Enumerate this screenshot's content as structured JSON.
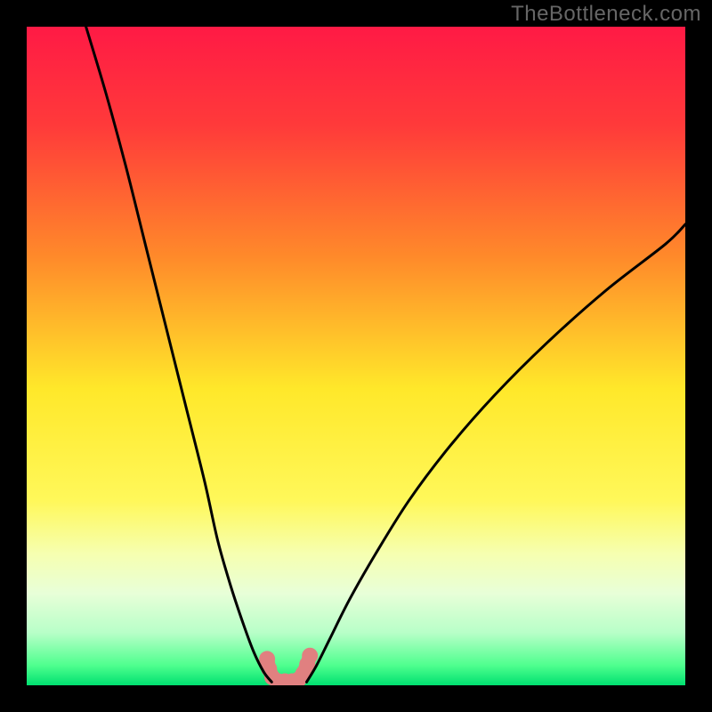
{
  "watermark": "TheBottleneck.com",
  "chart_data": {
    "type": "line",
    "title": "",
    "xlabel": "",
    "ylabel": "",
    "xlim": [
      0,
      100
    ],
    "ylim": [
      0,
      100
    ],
    "background_gradient": {
      "stops": [
        {
          "offset": 0.0,
          "color": "#ff1a45"
        },
        {
          "offset": 0.15,
          "color": "#ff3a3a"
        },
        {
          "offset": 0.35,
          "color": "#ff8a2a"
        },
        {
          "offset": 0.55,
          "color": "#ffe82a"
        },
        {
          "offset": 0.72,
          "color": "#fff85a"
        },
        {
          "offset": 0.8,
          "color": "#f6ffb0"
        },
        {
          "offset": 0.86,
          "color": "#e8ffd8"
        },
        {
          "offset": 0.92,
          "color": "#b8ffc8"
        },
        {
          "offset": 0.97,
          "color": "#4eff8e"
        },
        {
          "offset": 1.0,
          "color": "#00e070"
        }
      ]
    },
    "series": [
      {
        "name": "left-curve",
        "type": "line",
        "color": "#000000",
        "x": [
          9,
          12,
          15,
          18,
          21,
          24,
          27,
          29,
          31,
          33,
          34.5,
          36,
          37.2
        ],
        "y": [
          100,
          90,
          79,
          67,
          55,
          43,
          31,
          22,
          15,
          9,
          5,
          2,
          0.5
        ]
      },
      {
        "name": "right-curve",
        "type": "line",
        "color": "#000000",
        "x": [
          42.5,
          44,
          46,
          49,
          53,
          58,
          64,
          71,
          79,
          88,
          97,
          100
        ],
        "y": [
          0.5,
          3,
          7,
          13,
          20,
          28,
          36,
          44,
          52,
          60,
          67,
          70
        ]
      },
      {
        "name": "valley-zone",
        "type": "scatter",
        "color": "#e08080",
        "x": [
          36.5,
          36.8,
          37.3,
          38.2,
          39.2,
          40.3,
          41.3,
          42.0,
          42.6,
          43.0
        ],
        "y": [
          4.0,
          2.5,
          1.2,
          0.6,
          0.6,
          0.6,
          0.9,
          1.8,
          3.2,
          4.5
        ]
      }
    ]
  }
}
